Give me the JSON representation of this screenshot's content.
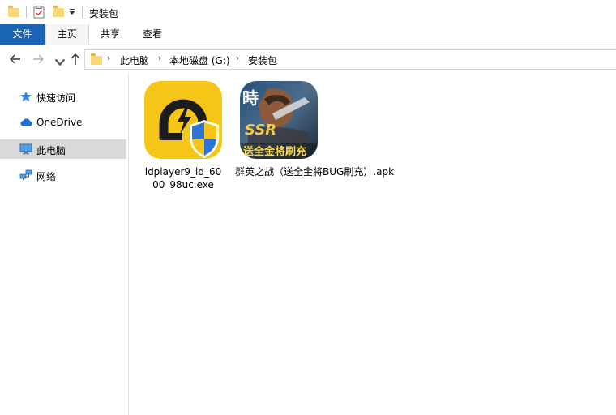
{
  "window": {
    "title": "安装包"
  },
  "ribbon": {
    "tabs": [
      {
        "label": "文件"
      },
      {
        "label": "主页"
      },
      {
        "label": "共享"
      },
      {
        "label": "查看"
      }
    ]
  },
  "address_bar": {
    "crumbs": [
      "此电脑",
      "本地磁盘 (G:)",
      "安装包"
    ]
  },
  "sidebar": {
    "items": [
      {
        "label": "快速访问",
        "icon": "star-icon"
      },
      {
        "label": "OneDrive",
        "icon": "cloud-icon"
      },
      {
        "label": "此电脑",
        "icon": "computer-icon",
        "selected": true
      },
      {
        "label": "网络",
        "icon": "network-icon"
      }
    ]
  },
  "files": [
    {
      "name_line1": "ldplayer9_ld_60",
      "name_line2": "00_98uc.exe",
      "icon": "ldplayer-installer-icon"
    },
    {
      "name_line1": "群英之战（送全金将BUG刷充）.apk",
      "icon": "game-apk-icon",
      "icon_text": "送全金将刷充"
    }
  ],
  "colors": {
    "accent": "#1a64b5",
    "selected_bg": "#d9d9d9",
    "ldplayer_bg": "#f5c518"
  }
}
